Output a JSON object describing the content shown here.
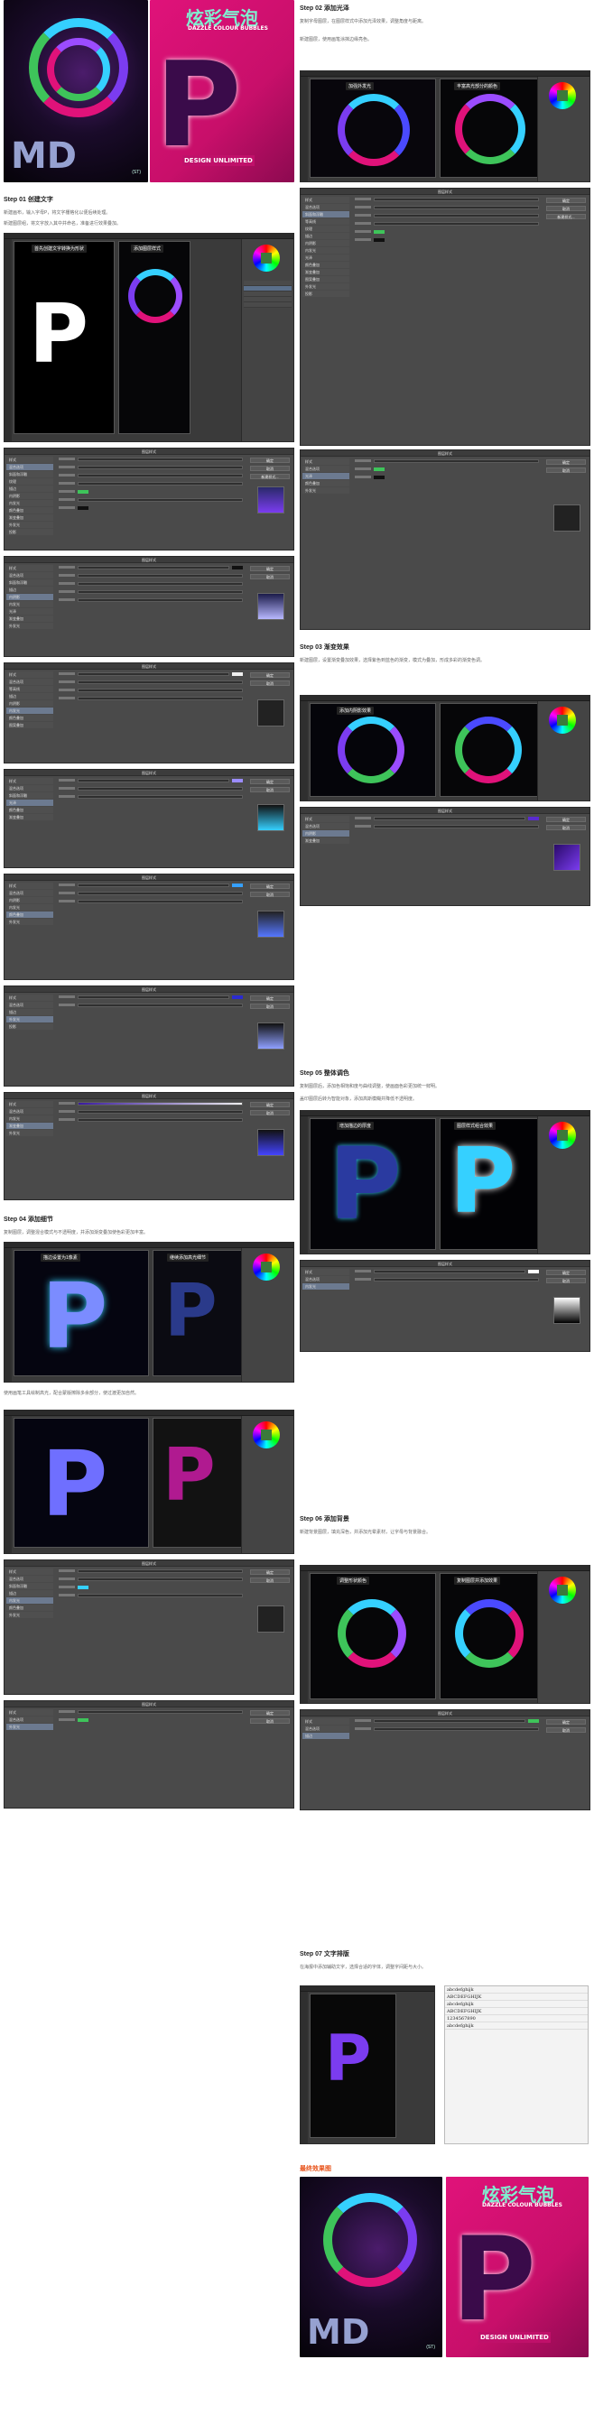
{
  "colors": {
    "dark_bg": "#060608",
    "purple": "#4b1c6b",
    "magenta": "#e0127a",
    "cyan": "#35d0ff",
    "green": "#3ec45a",
    "orange_title": "#e8541c"
  },
  "poster_dark": {
    "title": "MD",
    "corner_text": "(ST)"
  },
  "poster_magenta": {
    "headline": "炫彩气泡",
    "subheadline": "DAZZLE COLOUR BUBBLES",
    "badge": "DESIGN UNLIMITED",
    "glyph": "P"
  },
  "left": {
    "step1": {
      "title": "Step 01 创建文字",
      "text": "新建画布，输入字母P，将文字栅格化以便后续处理。",
      "hint": "新建图层组，将文字放入其中并命名，准备进行效果叠加。"
    },
    "ps1": {
      "tag_a": "首先创建文字转换为形状",
      "tag_b": "添加图层样式"
    },
    "dialog_title": "图层样式",
    "dialog_buttons": [
      "确定",
      "取消",
      "新建样式...",
      "预览"
    ],
    "dialog_items": [
      "样式",
      "混合选项",
      "斜面和浮雕",
      "等高线",
      "纹理",
      "描边",
      "内阴影",
      "内发光",
      "光泽",
      "颜色叠加",
      "渐变叠加",
      "图案叠加",
      "外发光",
      "投影"
    ],
    "step4": {
      "title": "Step 04 添加细节",
      "text": "复制图层，调整混合模式与不透明度，并添加渐变叠加使色彩更加丰富。"
    },
    "ps4": {
      "tag_a": "描边设置为1像素",
      "tag_b": "继续添加高光细节"
    },
    "step4b_text": "使用画笔工具绘制高光，配合蒙版擦除多余部分，使过渡更加自然。"
  },
  "right": {
    "step2": {
      "title": "Step 02 添加光泽",
      "text": "复制字母图层，在图层样式中添加光泽效果，调整角度与距离。",
      "hint": "新建图层，使用画笔涂抹边缘亮色。"
    },
    "ps2": {
      "tag_a": "加强外发光",
      "tag_b": "丰富高光部分的颜色"
    },
    "step3": {
      "title": "Step 03 渐变效果",
      "text": "新建图层，设置渐变叠加效果，选择紫色到蓝色的渐变，模式为叠加，形成多彩的渐变色调。"
    },
    "ps3": {
      "tag_a": "添加内阴影效果"
    },
    "step5": {
      "title": "Step 05 整体调色",
      "text": "复制图层后，添加色相饱和度与曲线调整，使画面色彩更加统一鲜明。",
      "text2": "盖印图层后转为智能对象，添加高斯模糊并降低不透明度。"
    },
    "ps5": {
      "tag_a": "增加描边的厚度",
      "tag_b": "图层样式组合效果"
    },
    "step6": {
      "title": "Step 06 添加背景",
      "text": "新建背景图层，填充深色，并添加光晕素材，让字母与背景融合。"
    },
    "ps6": {
      "tag_a": "调整形状颜色",
      "tag_b": "复制图层并添加效果"
    },
    "step7": {
      "title": "Step 07 文字排版",
      "text": "在海报中添加辅助文字，选择合适的字体，调整字间距与大小。"
    },
    "fonts": [
      "abcdefghijk",
      "ABCDEFGHIJK",
      "abcdefghijk",
      "ABCDEFGHIJK",
      "1234567890",
      "abcdefghijk"
    ],
    "result_title": "最终效果图"
  }
}
